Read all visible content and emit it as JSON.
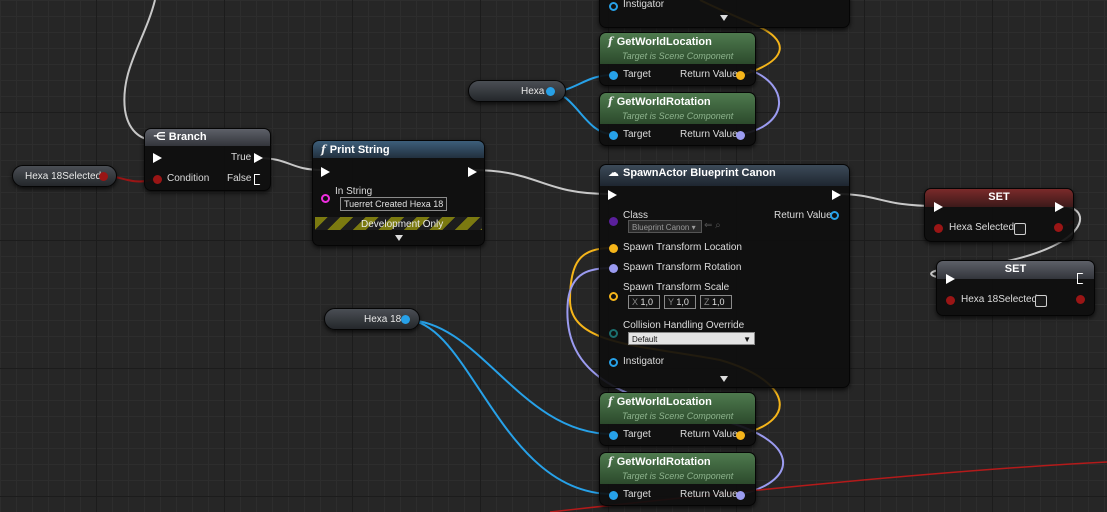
{
  "colors": {
    "exec": "#ffffff",
    "vector": "#f5b51a",
    "rotator": "#9b9bf0",
    "object": "#27a1e8",
    "bool": "#9a1515",
    "string": "#f02ee0",
    "class": "#5a1f9c"
  },
  "nodes": {
    "top_partial": {
      "pin": "Instigator"
    },
    "gwl_top": {
      "title": "GetWorldLocation",
      "subtitle": "Target is Scene Component",
      "in": "Target",
      "out": "Return Value"
    },
    "gwr_top": {
      "title": "GetWorldRotation",
      "subtitle": "Target is Scene Component",
      "in": "Target",
      "out": "Return Value"
    },
    "gwl_bottom": {
      "title": "GetWorldLocation",
      "subtitle": "Target is Scene Component",
      "in": "Target",
      "out": "Return Value"
    },
    "gwr_bottom": {
      "title": "GetWorldRotation",
      "subtitle": "Target is Scene Component",
      "in": "Target",
      "out": "Return Value"
    },
    "branch": {
      "title": "Branch",
      "true": "True",
      "false": "False",
      "condition": "Condition"
    },
    "print": {
      "title": "Print String",
      "in_string_label": "In String",
      "in_string_value": "Tuerret Created Hexa 18",
      "dev": "Development Only"
    },
    "spawn": {
      "title": "SpawnActor Blueprint Canon",
      "class_label": "Class",
      "class_value": "Blueprint Canon",
      "return": "Return Value",
      "loc": "Spawn Transform Location",
      "rot": "Spawn Transform Rotation",
      "scale": "Spawn Transform Scale",
      "sx_label": "X",
      "sx": "1,0",
      "sy_label": "Y",
      "sy": "1,0",
      "sz_label": "Z",
      "sz": "1,0",
      "collision": "Collision Handling Override",
      "collision_value": "Default",
      "instigator": "Instigator"
    },
    "set1": {
      "title": "SET",
      "var": "Hexa Selected"
    },
    "set2": {
      "title": "SET",
      "var": "Hexa 18Selected"
    }
  },
  "variables": {
    "hexa": "Hexa",
    "hexa18": "Hexa 18",
    "hexa18selected": "Hexa 18Selected"
  }
}
